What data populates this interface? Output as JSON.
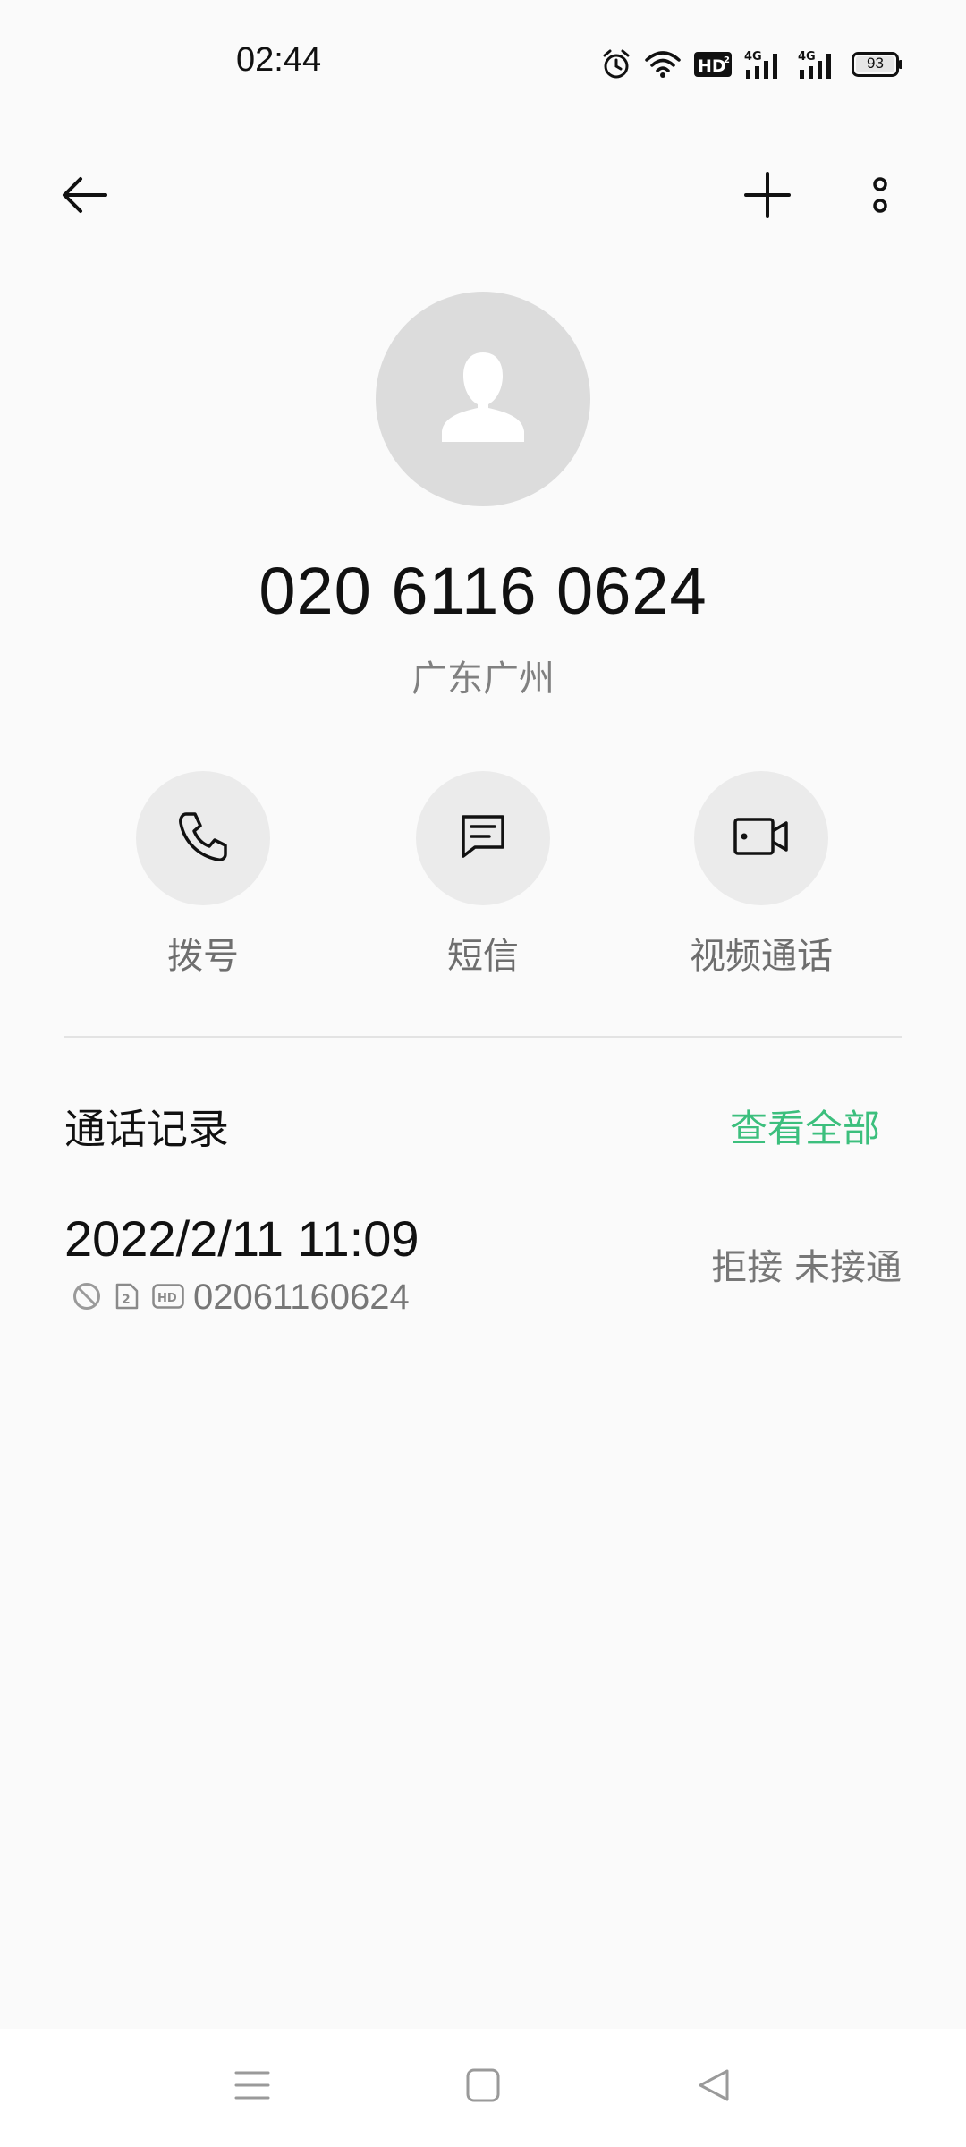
{
  "status_bar": {
    "time": "02:44",
    "battery": "93",
    "icons": [
      "alarm-icon",
      "wifi-icon",
      "hd-voice-icon",
      "signal-4g-sim1-icon",
      "signal-4g-sim2-icon",
      "battery-icon"
    ]
  },
  "top_bar": {
    "icons": [
      "back-arrow-icon",
      "add-icon",
      "more-vertical-icon"
    ]
  },
  "contact": {
    "avatar_icon": "person-placeholder-icon",
    "number": "020 6116 0624",
    "location": "广东广州"
  },
  "actions": [
    {
      "label": "拨号",
      "icon": "phone-icon"
    },
    {
      "label": "短信",
      "icon": "message-icon"
    },
    {
      "label": "视频通话",
      "icon": "video-call-icon"
    }
  ],
  "call_log": {
    "title": "通话记录",
    "view_all": "查看全部",
    "accent_color": "#3cbf7d",
    "entries": [
      {
        "datetime": "2022/2/11 11:09",
        "number": "02061160624",
        "status": "拒接 未接通",
        "icons": [
          "blocked-icon",
          "sim-2-icon",
          "hd-icon"
        ]
      }
    ]
  },
  "nav_bar": {
    "icons": [
      "menu-icon",
      "home-icon",
      "back-triangle-icon"
    ]
  }
}
